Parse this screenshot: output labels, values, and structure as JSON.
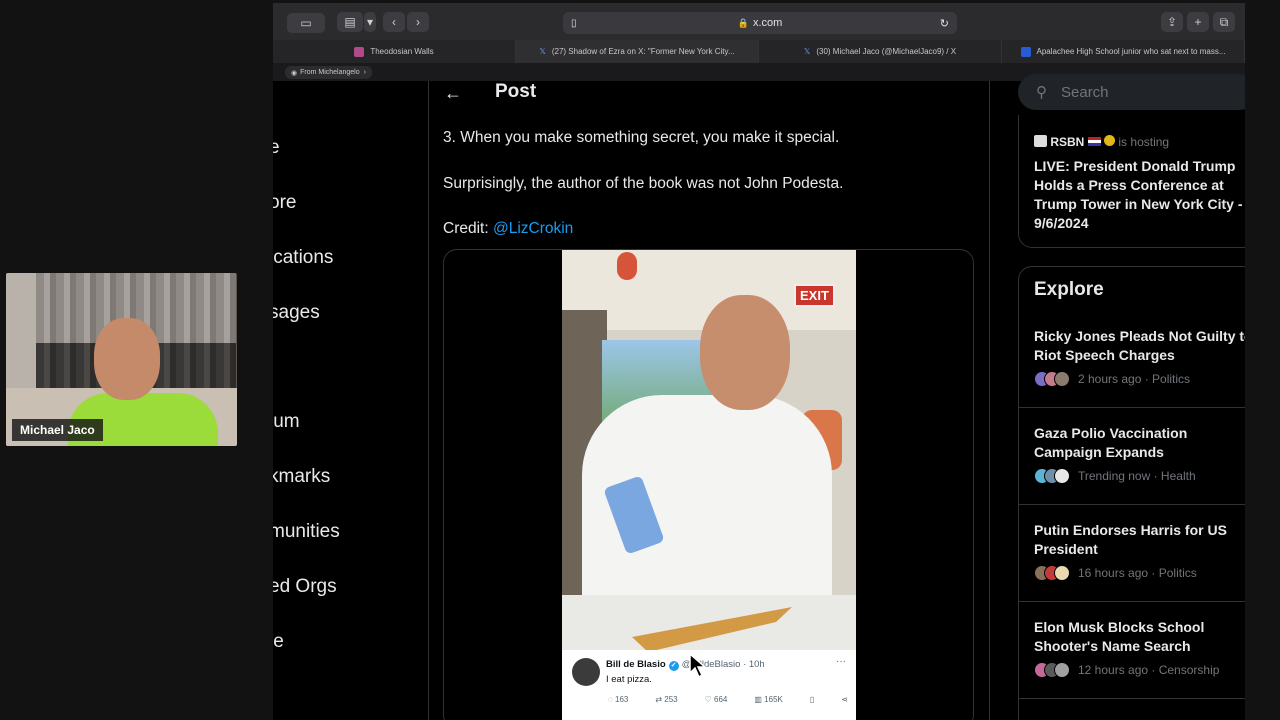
{
  "webcam": {
    "name": "Michael Jaco"
  },
  "browser": {
    "url": "x.com",
    "tabs": [
      {
        "label": "Theodosian Walls"
      },
      {
        "label": "(27) Shadow of Ezra on X: \"Former New York City..."
      },
      {
        "label": "(30) Michael Jaco (@MichaelJaco9) / X"
      },
      {
        "label": "Apalachee High School junior who sat next to mass..."
      }
    ],
    "from_label": "From Michelangelo"
  },
  "leftnav": {
    "items": [
      "e",
      "ore",
      "ications",
      "sages",
      "ium",
      "kmarks",
      "munities",
      "ed Orgs",
      "le"
    ]
  },
  "post": {
    "heading": "Post",
    "line1": "3. When you make something secret, you make it special.",
    "line2": "Surprisingly, the author of the book was not John Podesta.",
    "credit_prefix": "Credit: ",
    "credit_mention": "@LizCrokin",
    "photo_exit": "EXIT",
    "quote": {
      "name": "Bill de Blasio",
      "handle": "@BilldeBlasio",
      "time": "· 10h",
      "text": "I eat pizza.",
      "replies": "163",
      "reposts": "253",
      "likes": "664",
      "views": "165K"
    }
  },
  "right": {
    "search_placeholder": "Search",
    "hosting": {
      "source": "RSBN",
      "status": "is hosting",
      "title": "LIVE: President Donald Trump Holds a Press Conference at Trump Tower in New York City - 9/6/2024"
    },
    "explore": {
      "heading": "Explore",
      "topics": [
        {
          "title": "Ricky Jones Pleads Not Guilty to Riot Speech Charges",
          "meta": "2 hours ago · Politics",
          "colors": [
            "#7b6cc4",
            "#c47b8e",
            "#8a7b6e"
          ]
        },
        {
          "title": "Gaza Polio Vaccination Campaign Expands",
          "meta": "Trending now · Health",
          "colors": [
            "#5ab4d6",
            "#6f8fa8",
            "#e6e6e6"
          ]
        },
        {
          "title": "Putin Endorses Harris for US President",
          "meta": "16 hours ago · Politics",
          "colors": [
            "#8a6f5a",
            "#c23b3b",
            "#e8d9b0"
          ]
        },
        {
          "title": "Elon Musk Blocks School Shooter's Name Search",
          "meta": "12 hours ago · Censorship",
          "colors": [
            "#c46a9a",
            "#5a5a5a",
            "#a0a0a0"
          ]
        }
      ]
    }
  }
}
